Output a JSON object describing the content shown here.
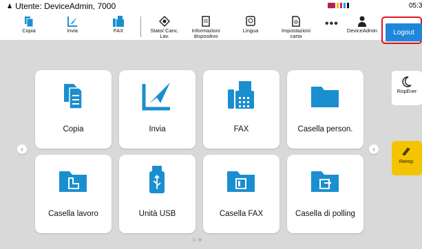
{
  "status": {
    "user_line": "Utente: DeviceAdmin, 7000",
    "time": "05:3"
  },
  "toolbar": {
    "items": [
      {
        "label": "Copia",
        "icon": "copy-icon"
      },
      {
        "label": "Invia",
        "icon": "send-icon"
      },
      {
        "label": "FAX",
        "icon": "fax-icon"
      },
      {
        "label": "Stato/ Canc. Lav.",
        "icon": "status-icon"
      },
      {
        "label": "Informazioni dispositivo",
        "icon": "device-info-icon"
      },
      {
        "label": "Lingua",
        "icon": "language-icon"
      },
      {
        "label": "Impostazioni carta",
        "icon": "paper-settings-icon"
      },
      {
        "label": "DeviceAdmin",
        "icon": "user-icon"
      }
    ],
    "more": "•••",
    "logout": "Logout"
  },
  "tiles": [
    {
      "label": "Copia",
      "icon": "copy-icon"
    },
    {
      "label": "Invia",
      "icon": "send-icon"
    },
    {
      "label": "FAX",
      "icon": "fax-icon"
    },
    {
      "label": "Casella person.",
      "icon": "folder-icon"
    },
    {
      "label": "Casella lavoro",
      "icon": "job-box-icon"
    },
    {
      "label": "Unità USB",
      "icon": "usb-icon"
    },
    {
      "label": "Casella FAX",
      "icon": "fax-box-icon"
    },
    {
      "label": "Casella di polling",
      "icon": "polling-box-icon"
    }
  ],
  "side": {
    "energy_saver": "RispEner",
    "reset": "Reimp."
  },
  "colors": {
    "accent": "#1f86d9",
    "icon_blue": "#1a8fd0",
    "logout_highlight": "#e0141f",
    "reset_yellow": "#f5c400"
  }
}
